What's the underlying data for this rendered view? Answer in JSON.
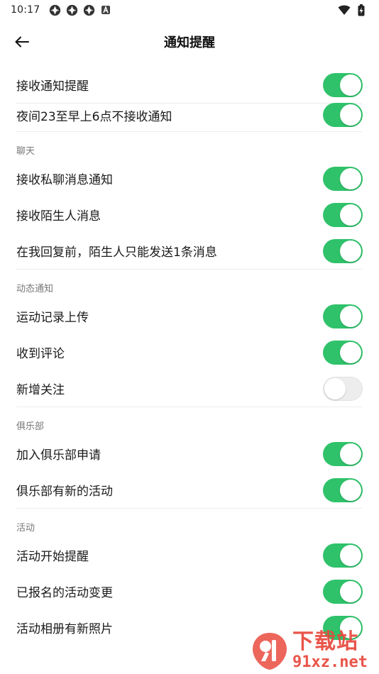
{
  "status": {
    "time": "10:17",
    "left_icons": [
      "app-icon",
      "app-icon",
      "app-icon",
      "notification-a-icon"
    ],
    "right_icons": [
      "wifi-icon",
      "battery-charging-icon"
    ]
  },
  "header": {
    "title": "通知提醒",
    "back_icon": "arrow-left-icon"
  },
  "colors": {
    "toggle_on": "#2fc26a",
    "toggle_off": "#ededed"
  },
  "general": {
    "items": [
      {
        "label": "接收通知提醒",
        "on": true
      },
      {
        "label": "夜间23至早上6点不接收通知",
        "on": true
      }
    ]
  },
  "sections": [
    {
      "title": "聊天",
      "items": [
        {
          "label": "接收私聊消息通知",
          "on": true
        },
        {
          "label": "接收陌生人消息",
          "on": true
        },
        {
          "label": "在我回复前，陌生人只能发送1条消息",
          "on": true
        }
      ]
    },
    {
      "title": "动态通知",
      "items": [
        {
          "label": "运动记录上传",
          "on": true
        },
        {
          "label": "收到评论",
          "on": true
        },
        {
          "label": "新增关注",
          "on": false
        }
      ]
    },
    {
      "title": "俱乐部",
      "items": [
        {
          "label": "加入俱乐部申请",
          "on": true
        },
        {
          "label": "俱乐部有新的活动",
          "on": true
        }
      ]
    },
    {
      "title": "活动",
      "items": [
        {
          "label": "活动开始提醒",
          "on": true
        },
        {
          "label": "已报名的活动变更",
          "on": true
        },
        {
          "label": "活动相册有新照片",
          "on": true
        }
      ]
    }
  ],
  "watermark": {
    "text_top": "下载站",
    "text_bottom": "91xz.net"
  }
}
